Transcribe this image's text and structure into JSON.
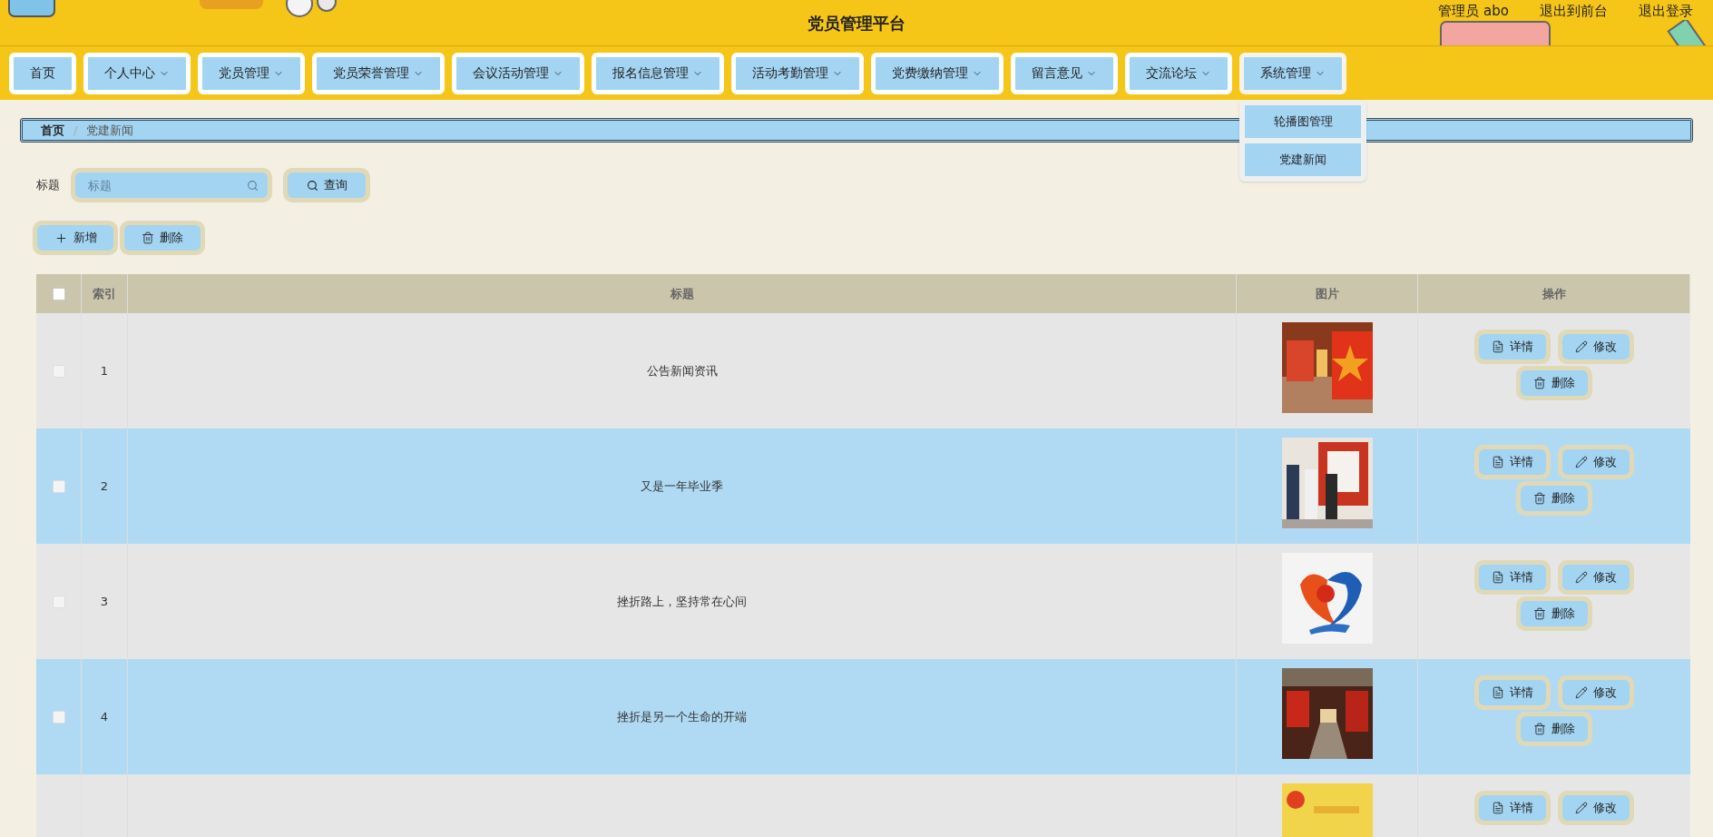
{
  "header": {
    "title": "党员管理平台",
    "links": [
      "管理员 abo",
      "退出到前台",
      "退出登录"
    ]
  },
  "nav": [
    {
      "label": "首页",
      "dropdown": false,
      "expanded": false
    },
    {
      "label": "个人中心",
      "dropdown": true,
      "expanded": false
    },
    {
      "label": "党员管理",
      "dropdown": true,
      "expanded": false
    },
    {
      "label": "党员荣誉管理",
      "dropdown": true,
      "expanded": false
    },
    {
      "label": "会议活动管理",
      "dropdown": true,
      "expanded": false
    },
    {
      "label": "报名信息管理",
      "dropdown": true,
      "expanded": false
    },
    {
      "label": "活动考勤管理",
      "dropdown": true,
      "expanded": false
    },
    {
      "label": "党费缴纳管理",
      "dropdown": true,
      "expanded": false
    },
    {
      "label": "留言意见",
      "dropdown": true,
      "expanded": false
    },
    {
      "label": "交流论坛",
      "dropdown": true,
      "expanded": false
    },
    {
      "label": "系统管理",
      "dropdown": true,
      "expanded": true,
      "menu": [
        "轮播图管理",
        "党建新闻"
      ]
    }
  ],
  "breadcrumb": {
    "separator": "/",
    "items": [
      {
        "label": "首页",
        "current": false
      },
      {
        "label": "党建新闻",
        "current": true
      }
    ]
  },
  "search": {
    "label": "标题",
    "placeholder": "标题",
    "button": "查询"
  },
  "actions": [
    {
      "kind": "add",
      "label": "新增"
    },
    {
      "kind": "delete",
      "label": "删除"
    }
  ],
  "table": {
    "header_checked": false,
    "columns": [
      "索引",
      "标题",
      "图片",
      "操作"
    ],
    "rows": [
      {
        "index": "1",
        "title": "公告新闻资讯",
        "checked": false,
        "actions": [
          {
            "kind": "detail",
            "label": "详情"
          },
          {
            "kind": "edit",
            "label": "修改"
          },
          {
            "kind": "delete",
            "label": "删除"
          }
        ]
      },
      {
        "index": "2",
        "title": "又是一年毕业季",
        "checked": false,
        "actions": [
          {
            "kind": "detail",
            "label": "详情"
          },
          {
            "kind": "edit",
            "label": "修改"
          },
          {
            "kind": "delete",
            "label": "删除"
          }
        ]
      },
      {
        "index": "3",
        "title": "挫折路上，坚持常在心间",
        "checked": false,
        "actions": [
          {
            "kind": "detail",
            "label": "详情"
          },
          {
            "kind": "edit",
            "label": "修改"
          },
          {
            "kind": "delete",
            "label": "删除"
          }
        ]
      },
      {
        "index": "4",
        "title": "挫折是另一个生命的开端",
        "checked": false,
        "actions": [
          {
            "kind": "detail",
            "label": "详情"
          },
          {
            "kind": "edit",
            "label": "修改"
          },
          {
            "kind": "delete",
            "label": "删除"
          }
        ]
      },
      {
        "actions": [
          {
            "kind": "detail",
            "label": "详情"
          },
          {
            "kind": "edit",
            "label": "修改"
          }
        ]
      }
    ]
  }
}
